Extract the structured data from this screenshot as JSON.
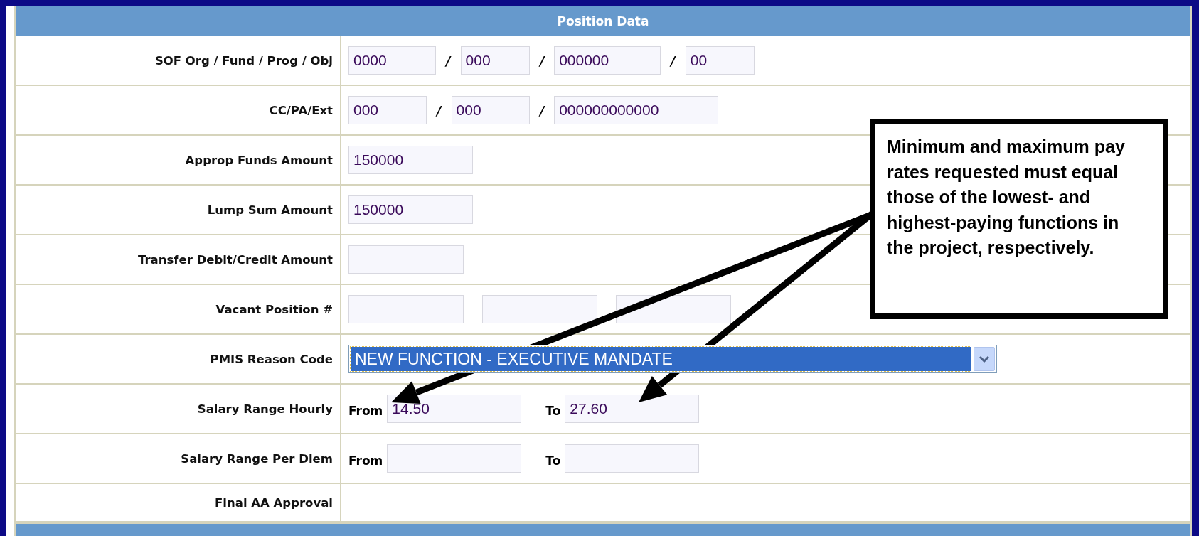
{
  "section": {
    "title": "Position Data"
  },
  "rows": [
    {
      "label": "SOF Org / Fund / Prog / Obj",
      "parts": [
        {
          "kind": "field",
          "value": "0000"
        },
        {
          "kind": "separator",
          "text": "/"
        },
        {
          "kind": "field",
          "value": "000"
        },
        {
          "kind": "separator",
          "text": "/"
        },
        {
          "kind": "field",
          "value": "000000"
        },
        {
          "kind": "separator",
          "text": "/"
        },
        {
          "kind": "field",
          "value": "00"
        }
      ]
    },
    {
      "label": "CC/PA/Ext",
      "parts": [
        {
          "kind": "field",
          "value": "000"
        },
        {
          "kind": "separator",
          "text": "/"
        },
        {
          "kind": "field",
          "value": "000"
        },
        {
          "kind": "separator",
          "text": "/"
        },
        {
          "kind": "field",
          "value": "000000000000"
        }
      ]
    },
    {
      "label": "Approp Funds Amount",
      "parts": [
        {
          "kind": "field",
          "value": "150000"
        }
      ]
    },
    {
      "label": "Lump Sum Amount",
      "parts": [
        {
          "kind": "field",
          "value": "150000"
        }
      ]
    },
    {
      "label": "Transfer Debit/Credit Amount",
      "parts": [
        {
          "kind": "field"
        }
      ]
    },
    {
      "label": "Vacant Position #",
      "parts": [
        {
          "kind": "field"
        },
        {
          "kind": "field"
        },
        {
          "kind": "field"
        }
      ]
    },
    {
      "label": "PMIS Reason Code",
      "parts": [
        {
          "kind": "select",
          "value": "NEW FUNCTION - EXECUTIVE MANDATE",
          "focused": true
        }
      ]
    },
    {
      "label": "Salary Range Hourly",
      "parts": [
        {
          "kind": "prefix",
          "text": "From"
        },
        {
          "kind": "field",
          "value": "14.50"
        },
        {
          "kind": "prefix",
          "text": "To"
        },
        {
          "kind": "field",
          "value": "27.60"
        }
      ]
    },
    {
      "label": "Salary Range Per Diem",
      "parts": [
        {
          "kind": "prefix",
          "text": "From"
        },
        {
          "kind": "field"
        },
        {
          "kind": "prefix",
          "text": "To"
        },
        {
          "kind": "field"
        }
      ]
    },
    {
      "label": "Final AA Approval",
      "parts": []
    }
  ],
  "callout": {
    "text": "Minimum and maximum pay rates requested must equal those of the lowest- and highest-paying functions in the project, respectively."
  }
}
